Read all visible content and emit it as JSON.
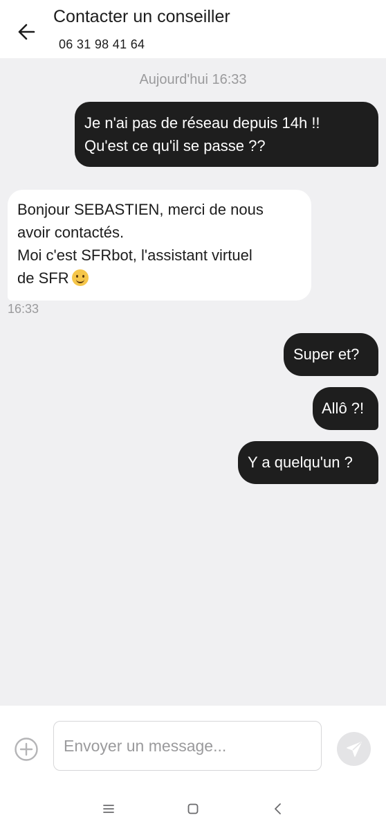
{
  "header": {
    "title": "Contacter un conseiller",
    "phone": "06 31 98 41 64"
  },
  "conversation": {
    "date_separator": "Aujourd'hui 16:33",
    "messages": [
      {
        "direction": "outgoing",
        "lines": [
          "Je n'ai pas de réseau depuis 14h !!",
          "Qu'est ce qu'il se passe ??"
        ]
      },
      {
        "direction": "incoming",
        "lines": [
          "Bonjour SEBASTIEN, merci de nous",
          "avoir contactés.",
          "Moi c'est SFRbot, l'assistant virtuel",
          "de SFR"
        ],
        "emoji": "smiling-face-emoji",
        "time": "16:33"
      },
      {
        "direction": "outgoing",
        "lines": [
          "Super et?"
        ]
      },
      {
        "direction": "outgoing",
        "lines": [
          "Allô ?!"
        ]
      },
      {
        "direction": "outgoing",
        "lines": [
          "Y a quelqu'un ?"
        ]
      }
    ]
  },
  "composer": {
    "placeholder": "Envoyer un message...",
    "value": ""
  },
  "icons": {
    "back": "arrow-left-icon",
    "add": "plus-circle-icon",
    "send": "send-icon",
    "nav_recents": "menu-lines-icon",
    "nav_home": "square-icon",
    "nav_back": "chevron-left-icon"
  },
  "colors": {
    "chat_background": "#f0f0f2",
    "outgoing_bubble": "#1e1e1e",
    "incoming_bubble": "#ffffff",
    "muted_text": "#9a9a9c"
  }
}
